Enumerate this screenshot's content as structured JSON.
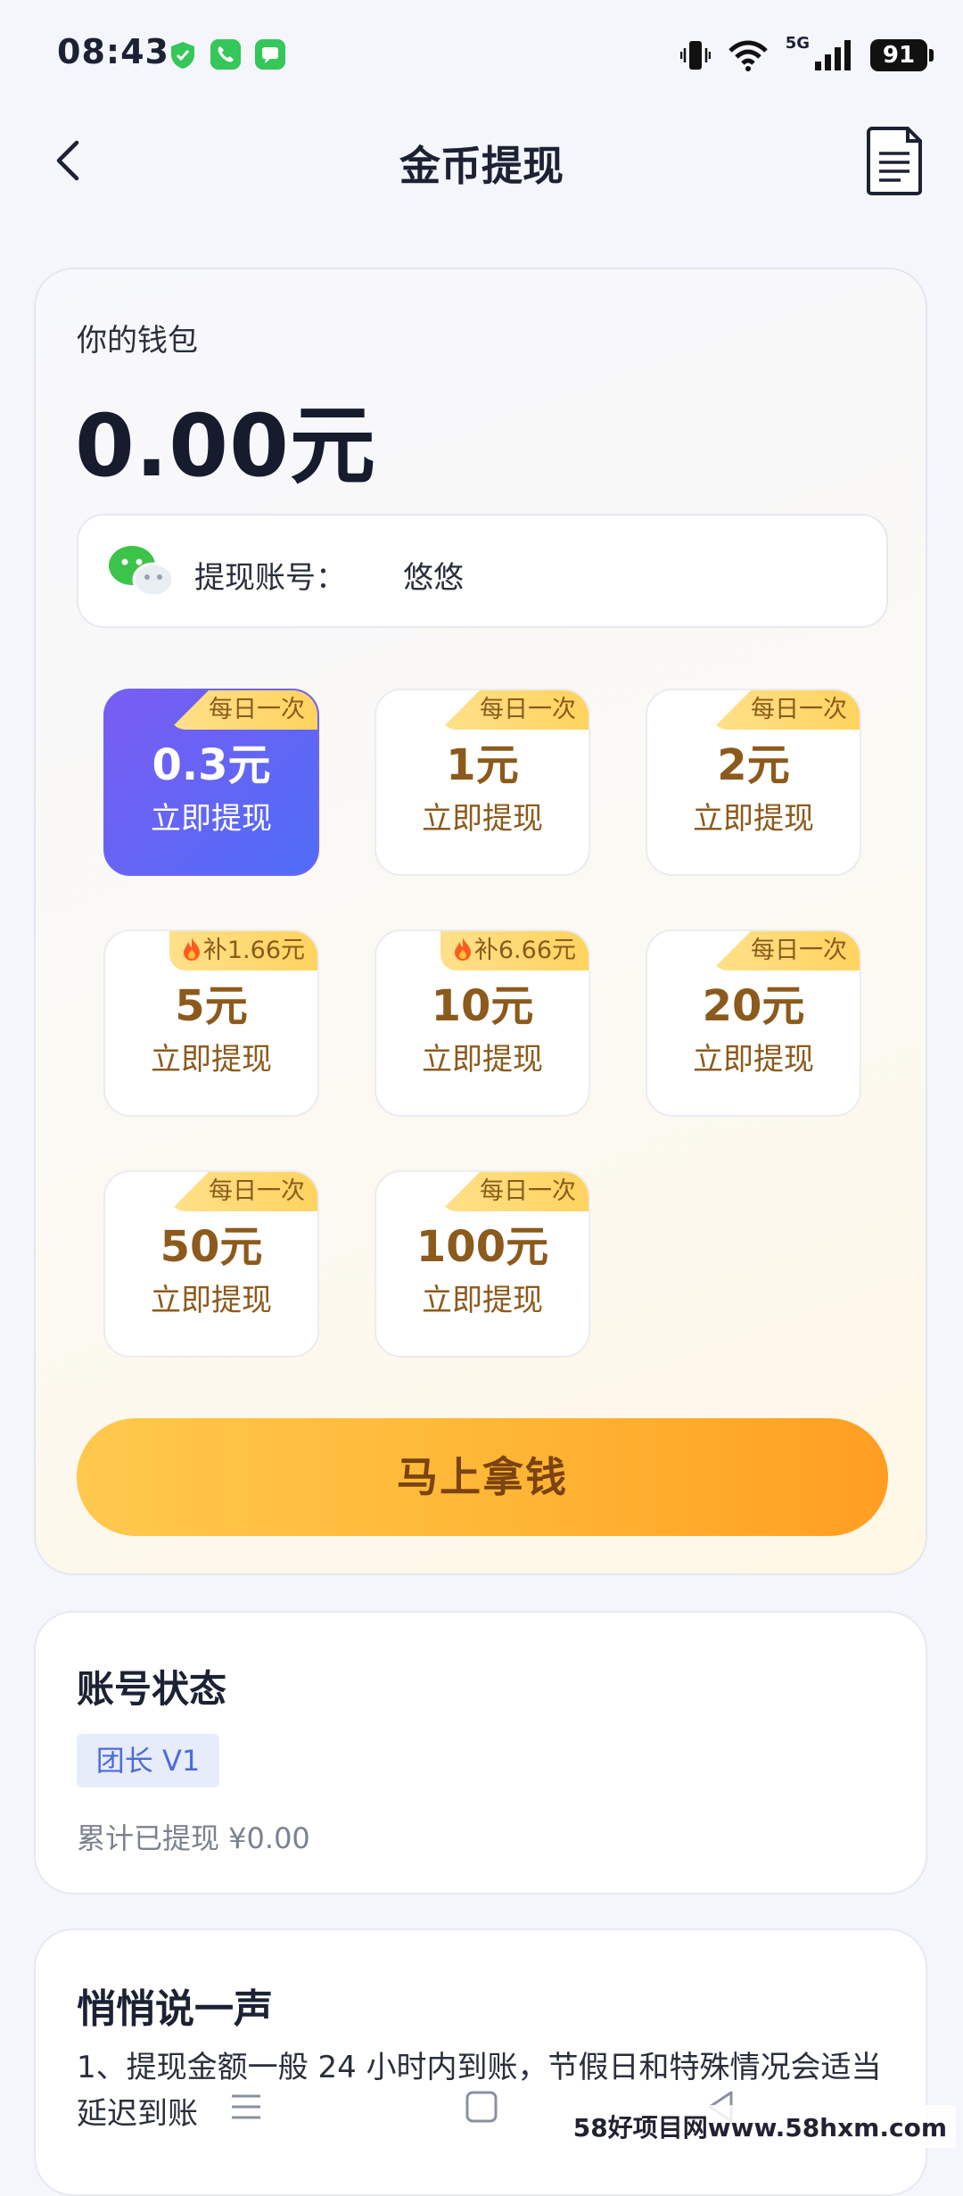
{
  "status_bar": {
    "time": "08:43",
    "battery": "91",
    "network": "5G"
  },
  "header": {
    "title": "金币提现"
  },
  "wallet": {
    "label": "你的钱包",
    "amount": "0.00元",
    "account_label": "提现账号：",
    "account_value": "悠悠"
  },
  "options": [
    {
      "badge": "每日一次",
      "fire": false,
      "amount": "0.3元",
      "action": "立即提现",
      "selected": true
    },
    {
      "badge": "每日一次",
      "fire": false,
      "amount": "1元",
      "action": "立即提现",
      "selected": false
    },
    {
      "badge": "每日一次",
      "fire": false,
      "amount": "2元",
      "action": "立即提现",
      "selected": false
    },
    {
      "badge": "补1.66元",
      "fire": true,
      "amount": "5元",
      "action": "立即提现",
      "selected": false
    },
    {
      "badge": "补6.66元",
      "fire": true,
      "amount": "10元",
      "action": "立即提现",
      "selected": false
    },
    {
      "badge": "每日一次",
      "fire": false,
      "amount": "20元",
      "action": "立即提现",
      "selected": false
    },
    {
      "badge": "每日一次",
      "fire": false,
      "amount": "50元",
      "action": "立即提现",
      "selected": false
    },
    {
      "badge": "每日一次",
      "fire": false,
      "amount": "100元",
      "action": "立即提现",
      "selected": false
    }
  ],
  "cta": {
    "label": "马上拿钱"
  },
  "account_status": {
    "title": "账号状态",
    "level": "团长 V1",
    "withdrawn": "累计已提现 ¥0.00"
  },
  "notice": {
    "title": "悄悄说一声",
    "text": "1、提现金额一般 24 小时内到账，节假日和特殊情况会适当延迟到账"
  },
  "watermark": "58好项目网www.58hxm.com",
  "icons": {
    "back": "chevron-left-icon",
    "records": "document-icon",
    "wechat": "wechat-icon",
    "fire": "fire-icon"
  },
  "colors": {
    "selected_start": "#7a5cf4",
    "selected_end": "#4f6df6",
    "gold_text": "#8c5a1c",
    "cta": "#ffb534"
  }
}
